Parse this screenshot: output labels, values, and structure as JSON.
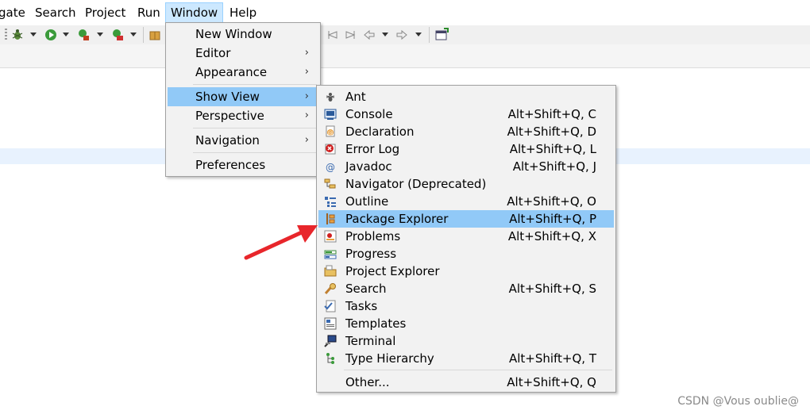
{
  "menubar": {
    "items": [
      {
        "label": "gate"
      },
      {
        "label": "Search"
      },
      {
        "label": "Project"
      },
      {
        "label": "Run"
      },
      {
        "label": "Window"
      },
      {
        "label": "Help"
      }
    ]
  },
  "toolbar": {
    "icons": [
      "debug-icon",
      "run-icon",
      "coverage-icon",
      "external-tools-icon",
      "new-package-icon",
      "prev-annotation-icon",
      "next-annotation-icon",
      "back-icon",
      "forward-icon",
      "open-perspective-icon"
    ]
  },
  "window_menu": {
    "items": [
      {
        "label": "New Window",
        "submenu": false
      },
      {
        "label": "Editor",
        "submenu": true
      },
      {
        "label": "Appearance",
        "submenu": true
      },
      {
        "label": "Show View",
        "submenu": true,
        "highlighted": true
      },
      {
        "label": "Perspective",
        "submenu": true
      },
      {
        "label": "Navigation",
        "submenu": true
      },
      {
        "label": "Preferences",
        "submenu": false
      }
    ],
    "submenu_glyph": "›"
  },
  "show_view_menu": {
    "items": [
      {
        "label": "Ant",
        "shortcut": "",
        "icon": "ant-icon"
      },
      {
        "label": "Console",
        "shortcut": "Alt+Shift+Q, C",
        "icon": "console-icon"
      },
      {
        "label": "Declaration",
        "shortcut": "Alt+Shift+Q, D",
        "icon": "declaration-icon"
      },
      {
        "label": "Error Log",
        "shortcut": "Alt+Shift+Q, L",
        "icon": "error-log-icon"
      },
      {
        "label": "Javadoc",
        "shortcut": "Alt+Shift+Q, J",
        "icon": "javadoc-icon"
      },
      {
        "label": "Navigator (Deprecated)",
        "shortcut": "",
        "icon": "navigator-icon"
      },
      {
        "label": "Outline",
        "shortcut": "Alt+Shift+Q, O",
        "icon": "outline-icon"
      },
      {
        "label": "Package Explorer",
        "shortcut": "Alt+Shift+Q, P",
        "icon": "package-explorer-icon",
        "highlighted": true
      },
      {
        "label": "Problems",
        "shortcut": "Alt+Shift+Q, X",
        "icon": "problems-icon"
      },
      {
        "label": "Progress",
        "shortcut": "",
        "icon": "progress-icon"
      },
      {
        "label": "Project Explorer",
        "shortcut": "",
        "icon": "project-explorer-icon"
      },
      {
        "label": "Search",
        "shortcut": "Alt+Shift+Q, S",
        "icon": "search-view-icon"
      },
      {
        "label": "Tasks",
        "shortcut": "",
        "icon": "tasks-icon"
      },
      {
        "label": "Templates",
        "shortcut": "",
        "icon": "templates-icon"
      },
      {
        "label": "Terminal",
        "shortcut": "",
        "icon": "terminal-icon"
      },
      {
        "label": "Type Hierarchy",
        "shortcut": "Alt+Shift+Q, T",
        "icon": "type-hierarchy-icon"
      },
      {
        "label": "Other...",
        "shortcut": "Alt+Shift+Q, Q",
        "icon": ""
      }
    ]
  },
  "colors": {
    "highlight": "#91c9f7",
    "menu_bg": "#f2f2f2",
    "annotation_arrow": "#e8262b"
  },
  "watermark": "CSDN @Vous oublie@"
}
